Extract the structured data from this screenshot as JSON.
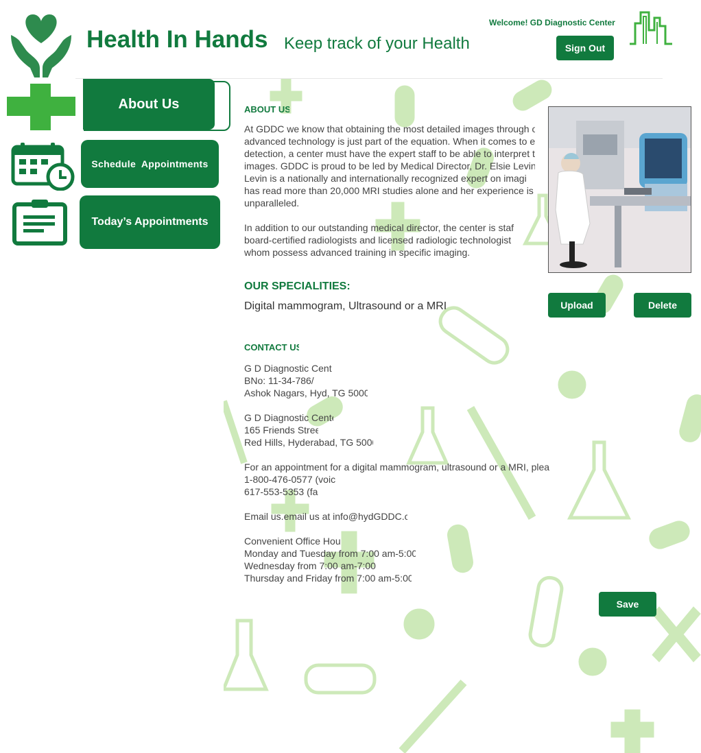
{
  "header": {
    "title": "Health In Hands",
    "tagline": "Keep track of your Health",
    "welcome": "Welcome! GD Diagnostic Center",
    "sign_out": "Sign Out"
  },
  "nav": {
    "about": "About Us",
    "schedule": "Schedule  Appointments",
    "today": "Today’s Appointments"
  },
  "about": {
    "heading": "ABOUT US",
    "p1": [
      "At GDDC we know that obtaining the most detailed images through o",
      "advanced technology is just part of the equation. When it comes to e",
      "detection, a center must have the expert staff to be able to interpret t",
      "images. GDDC is proud to be led by Medical Director, Dr. Elsie Levin.",
      "Levin is a nationally and internationally recognized expert on  imagi",
      "has read more than 20,000 MRI studies alone and her experience is",
      "unparalleled."
    ],
    "p2": [
      "In addition to our outstanding medical director, the center is staf",
      "board-certified radiologists and licensed radiologic technologist",
      "whom possess advanced training in specific imaging."
    ]
  },
  "specialities": {
    "heading": "OUR SPECIALITIES:",
    "text": "Digital mammogram, Ultrasound or a MRI"
  },
  "contact": {
    "heading": "CONTACT US",
    "address1": [
      "G D Diagnostic Cente",
      "BNo: 11-34-786/",
      "Ashok Nagars, Hyd, TG 5000"
    ],
    "address2": [
      "G D Diagnostic Cente",
      "165 Friends Stree",
      "Red Hills, Hyderabad, TG 5000"
    ],
    "appointment": [
      "For an appointment for a digital mammogram, ultrasound or a  MRI, plea",
      "1-800-476-0577 (voic",
      "617-553-5353 (fa"
    ],
    "email": "Email us.email us at info@hydGDDC.c",
    "hours": [
      "Convenient Office Hou",
      "Monday and Tuesday from 7:00 am-5:00",
      "Wednesday from 7:00 am-7:00",
      "Thursday and Friday from 7:00 am-5:00"
    ]
  },
  "actions": {
    "upload": "Upload",
    "delete": "Delete",
    "save": "Save"
  },
  "colors": {
    "primary": "#117a3e",
    "icon_green": "#3fb13f",
    "pattern": "#c9e7b4"
  }
}
